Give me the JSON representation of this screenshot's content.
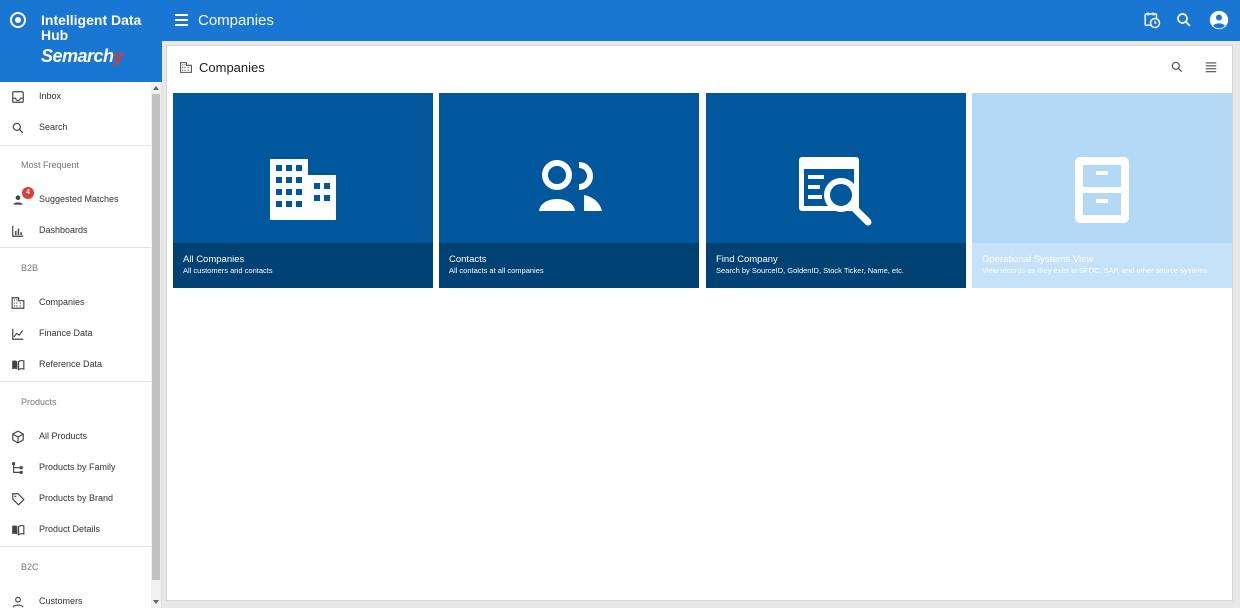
{
  "app": {
    "title": "Intelligent Data Hub",
    "wordmark_main": "Semarch",
    "wordmark_accent": "y"
  },
  "header": {
    "page_title": "Companies",
    "icons": [
      "calendar-clock-icon",
      "search-icon",
      "account-circle-icon"
    ]
  },
  "sidebar": {
    "items_top": [
      {
        "label": "Inbox",
        "icon": "inbox-icon"
      },
      {
        "label": "Search",
        "icon": "search-icon"
      }
    ],
    "sections": [
      {
        "label": "Most Frequent",
        "items": [
          {
            "label": "Suggested Matches",
            "icon": "person-icon",
            "badge": "4"
          },
          {
            "label": "Dashboards",
            "icon": "bar-chart-icon"
          }
        ]
      },
      {
        "label": "B2B",
        "items": [
          {
            "label": "Companies",
            "icon": "building-icon"
          },
          {
            "label": "Finance Data",
            "icon": "line-chart-icon"
          },
          {
            "label": "Reference Data",
            "icon": "book-icon"
          }
        ]
      },
      {
        "label": "Products",
        "items": [
          {
            "label": "All Products",
            "icon": "box-icon"
          },
          {
            "label": "Products by Family",
            "icon": "tree-icon"
          },
          {
            "label": "Products by Brand",
            "icon": "tag-icon"
          },
          {
            "label": "Product Details",
            "icon": "book-icon"
          }
        ]
      },
      {
        "label": "B2C",
        "items": [
          {
            "label": "Customers",
            "icon": "person-icon"
          }
        ]
      }
    ]
  },
  "main": {
    "title": "Companies",
    "actions": [
      "search-icon",
      "list-icon"
    ],
    "tiles": [
      {
        "title": "All Companies",
        "subtitle": "All customers and contacts",
        "icon": "building-icon"
      },
      {
        "title": "Contacts",
        "subtitle": "All contacts at all companies",
        "icon": "people-icon"
      },
      {
        "title": "Find Company",
        "subtitle": "Search by SourceID, GoldenID, Stock Ticker, Name, etc.",
        "icon": "find-record-icon"
      },
      {
        "title": "Operational Systems View",
        "subtitle": "View records as they exist in SFDC, SAP, and other source systems",
        "icon": "file-cabinet-icon"
      }
    ]
  },
  "colors": {
    "primary": "#1976d2",
    "tile": "#01579b",
    "tile_light": "#b3d9f7",
    "badge": "#e53935"
  }
}
